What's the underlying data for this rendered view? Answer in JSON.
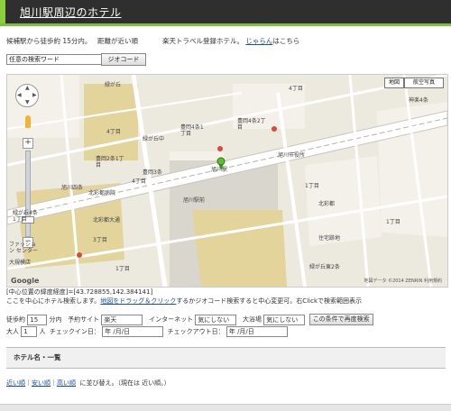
{
  "header": {
    "title": "旭川駅周辺のホテル"
  },
  "info": {
    "radius_text": "候補駅から徒歩約 15分内。",
    "sort_text": "距離が近い順",
    "rakuten_text": "楽天トラベル登録ホテル。",
    "link": "じゃらん",
    "suffix": "はこちら"
  },
  "search": {
    "value": "任意の検索ワード",
    "button": "ジオコード"
  },
  "map": {
    "type_buttons": [
      "地図",
      "航空写真"
    ],
    "labels": [
      "緑が丘",
      "4丁目",
      "4丁目",
      "緑が丘中",
      "豊岡4条1丁目",
      "豊岡4条2丁目",
      "豊岡2条1丁目",
      "旭川駅",
      "旭川市役所",
      "4丁目",
      "3丁目",
      "1丁目",
      "神楽4条",
      "北彩都病院",
      "北彩都",
      "住宅跡地",
      "緑が丘4条1丁目",
      "緑が丘東2条",
      "ファッション センター",
      "大規模店",
      "北彩都大通",
      "1丁目",
      "1丁目",
      "豊岡3条",
      "旭川四条",
      "旭川駅前"
    ],
    "copyright": "地図データ ©2014 ZENRIN  利用規約",
    "google": "Google"
  },
  "center": {
    "line1": "[中心位置の緯度経度]=[43.728855,142.384141]",
    "line2_prefix": "ここを中心にホテル検索します。",
    "drag_link": "地図をドラッグ＆クリック",
    "mid": "するかジオコード検索すると中心変更可。右Clickで検索範囲表示"
  },
  "filters": {
    "walk_label": "徒歩約",
    "walk_value": "15",
    "walk_unit": "分内",
    "site_label": "予約サイト",
    "site_value": "楽天",
    "net_label": "インターネット",
    "net_value": "気にしない",
    "bath_label": "大浴場",
    "bath_value": "気にしない",
    "search_button": "この条件で再度検索",
    "adults_label": "大人",
    "adults_value": "1",
    "adults_unit": "人",
    "checkin_label": "チェックイン日：",
    "checkin_value": "年 /月/日",
    "checkout_label": "チェックアウト日：",
    "checkout_value": "年 /月/日"
  },
  "list": {
    "header": "ホテル名・一覧"
  },
  "sort_links": {
    "near": "近い順",
    "cheap": "安い順",
    "expensive": "高い順",
    "note": "に並び替え。（現在は 近い順。）"
  }
}
